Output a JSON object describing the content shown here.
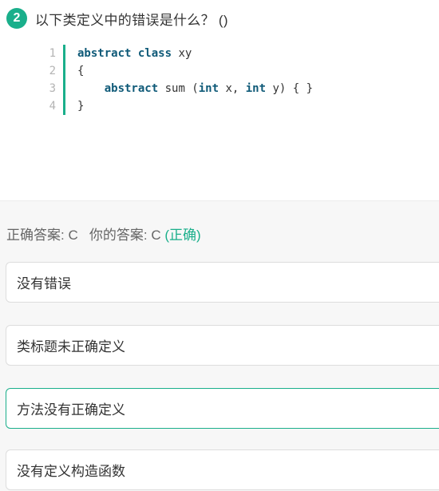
{
  "question": {
    "number": "2",
    "text": "以下类定义中的错误是什么？ ()"
  },
  "code": {
    "lines": [
      {
        "num": "1",
        "tokens": [
          {
            "t": "abstract",
            "kw": true
          },
          {
            "t": " "
          },
          {
            "t": "class",
            "kw": true
          },
          {
            "t": " xy"
          }
        ]
      },
      {
        "num": "2",
        "tokens": [
          {
            "t": "{"
          }
        ]
      },
      {
        "num": "3",
        "tokens": [
          {
            "t": "    "
          },
          {
            "t": "abstract",
            "kw": true
          },
          {
            "t": " sum ("
          },
          {
            "t": "int",
            "kw": true
          },
          {
            "t": " x, "
          },
          {
            "t": "int",
            "kw": true
          },
          {
            "t": " y) { }"
          }
        ]
      },
      {
        "num": "4",
        "tokens": [
          {
            "t": "}"
          }
        ]
      }
    ]
  },
  "answer": {
    "correct_label": "正确答案: C",
    "your_label": "你的答案: C",
    "result": "(正确)"
  },
  "options": [
    {
      "label": "没有错误",
      "selected": false
    },
    {
      "label": "类标题未正确定义",
      "selected": false
    },
    {
      "label": "方法没有正确定义",
      "selected": true
    },
    {
      "label": "没有定义构造函数",
      "selected": false
    }
  ],
  "colors": {
    "accent": "#1aaf8b",
    "keyword": "#0f5a78"
  }
}
